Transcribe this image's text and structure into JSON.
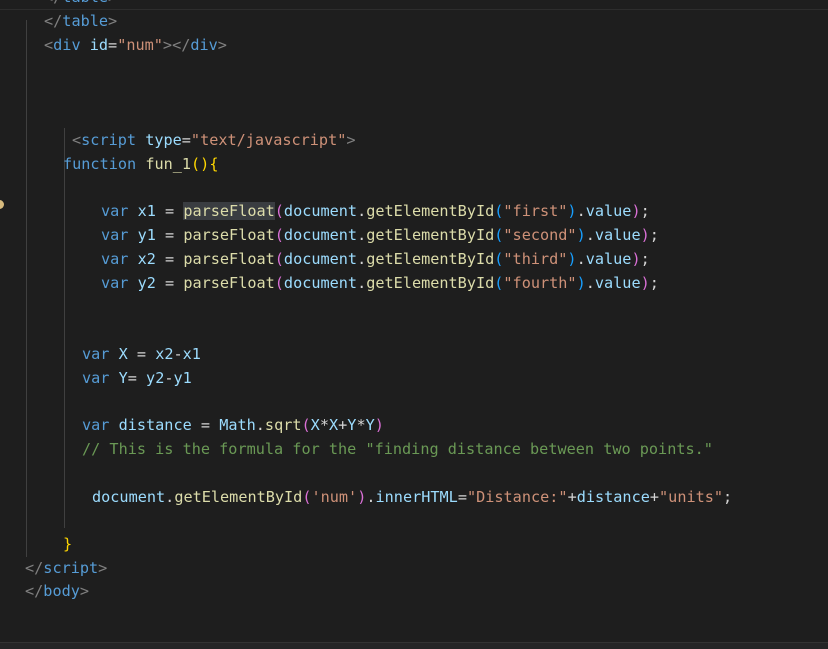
{
  "code": {
    "l_table_close": {
      "lt": "</",
      "tag": "table",
      "gt": ">"
    },
    "l_div": {
      "lt": "<",
      "tag": "div",
      "attr": "id",
      "eq": "=",
      "val": "\"num\"",
      "gt": "></",
      "tag2": "div",
      "gt2": ">"
    },
    "l_script_open": {
      "lt": "<",
      "tag": "script",
      "attr": "type",
      "eq": "=",
      "val": "\"text/javascript\"",
      "gt": ">"
    },
    "l_function": {
      "kw": "function",
      "name": "fun_1",
      "parens": "()",
      "brace": "{"
    },
    "vars": [
      {
        "kw": "var",
        "name": "x1",
        "eq": " = ",
        "fn": "parseFloat",
        "p1": "(",
        "obj": "document",
        "dot": ".",
        "method": "getElementById",
        "p2": "(",
        "arg": "\"first\"",
        "p2c": ")",
        "dot2": ".",
        "prop": "value",
        "p1c": ")",
        "semi": ";"
      },
      {
        "kw": "var",
        "name": "y1",
        "eq": " = ",
        "fn": "parseFloat",
        "p1": "(",
        "obj": "document",
        "dot": ".",
        "method": "getElementById",
        "p2": "(",
        "arg": "\"second\"",
        "p2c": ")",
        "dot2": ".",
        "prop": "value",
        "p1c": ")",
        "semi": ";"
      },
      {
        "kw": "var",
        "name": "x2",
        "eq": " = ",
        "fn": "parseFloat",
        "p1": "(",
        "obj": "document",
        "dot": ".",
        "method": "getElementById",
        "p2": "(",
        "arg": "\"third\"",
        "p2c": ")",
        "dot2": ".",
        "prop": "value",
        "p1c": ")",
        "semi": ";"
      },
      {
        "kw": "var",
        "name": "y2",
        "eq": " = ",
        "fn": "parseFloat",
        "p1": "(",
        "obj": "document",
        "dot": ".",
        "method": "getElementById",
        "p2": "(",
        "arg": "\"fourth\"",
        "p2c": ")",
        "dot2": ".",
        "prop": "value",
        "p1c": ")",
        "semi": ";"
      }
    ],
    "l_varX": {
      "kw": "var",
      "name": "X",
      "rest": " = ",
      "a": "x2",
      "op": "-",
      "b": "x1"
    },
    "l_varY": {
      "kw": "var",
      "name": "Y",
      "rest": "= ",
      "a": "y2",
      "op": "-",
      "b": "y1"
    },
    "l_distance": {
      "kw": "var",
      "name": "distance",
      "eq": " = ",
      "obj": "Math",
      "dot": ".",
      "fn": "sqrt",
      "p": "(",
      "expr1": "X",
      "m1": "*",
      "expr2": "X",
      "plus": "+",
      "expr3": "Y",
      "m2": "*",
      "expr4": "Y",
      "pc": ")"
    },
    "l_comment": "// This is the formula for the \"finding distance between two points.\"",
    "l_inner": {
      "obj": "document",
      "dot": ".",
      "method": "getElementById",
      "p": "(",
      "arg": "'num'",
      "pc": ")",
      "dot2": ".",
      "prop": "innerHTML",
      "eq": "=",
      "s1": "\"Distance:\"",
      "plus1": "+",
      "v": "distance",
      "plus2": "+",
      "s2": "\"units\"",
      "semi": ";"
    },
    "l_close_brace": "}",
    "l_script_close": {
      "lt": "</",
      "tag": "script",
      "gt": ">"
    },
    "l_body_close": {
      "lt": "</",
      "tag": "body",
      "gt": ">"
    },
    "l_clipped_top": {
      "lt": "</",
      "tag": "table",
      "gt": ">"
    }
  },
  "colors": {
    "background": "#1e1e1e",
    "keyword": "#569cd6",
    "string": "#ce9178",
    "function": "#dcdcaa",
    "variable": "#9cdcfe",
    "comment": "#6a9955",
    "brace": "#ffd700"
  }
}
